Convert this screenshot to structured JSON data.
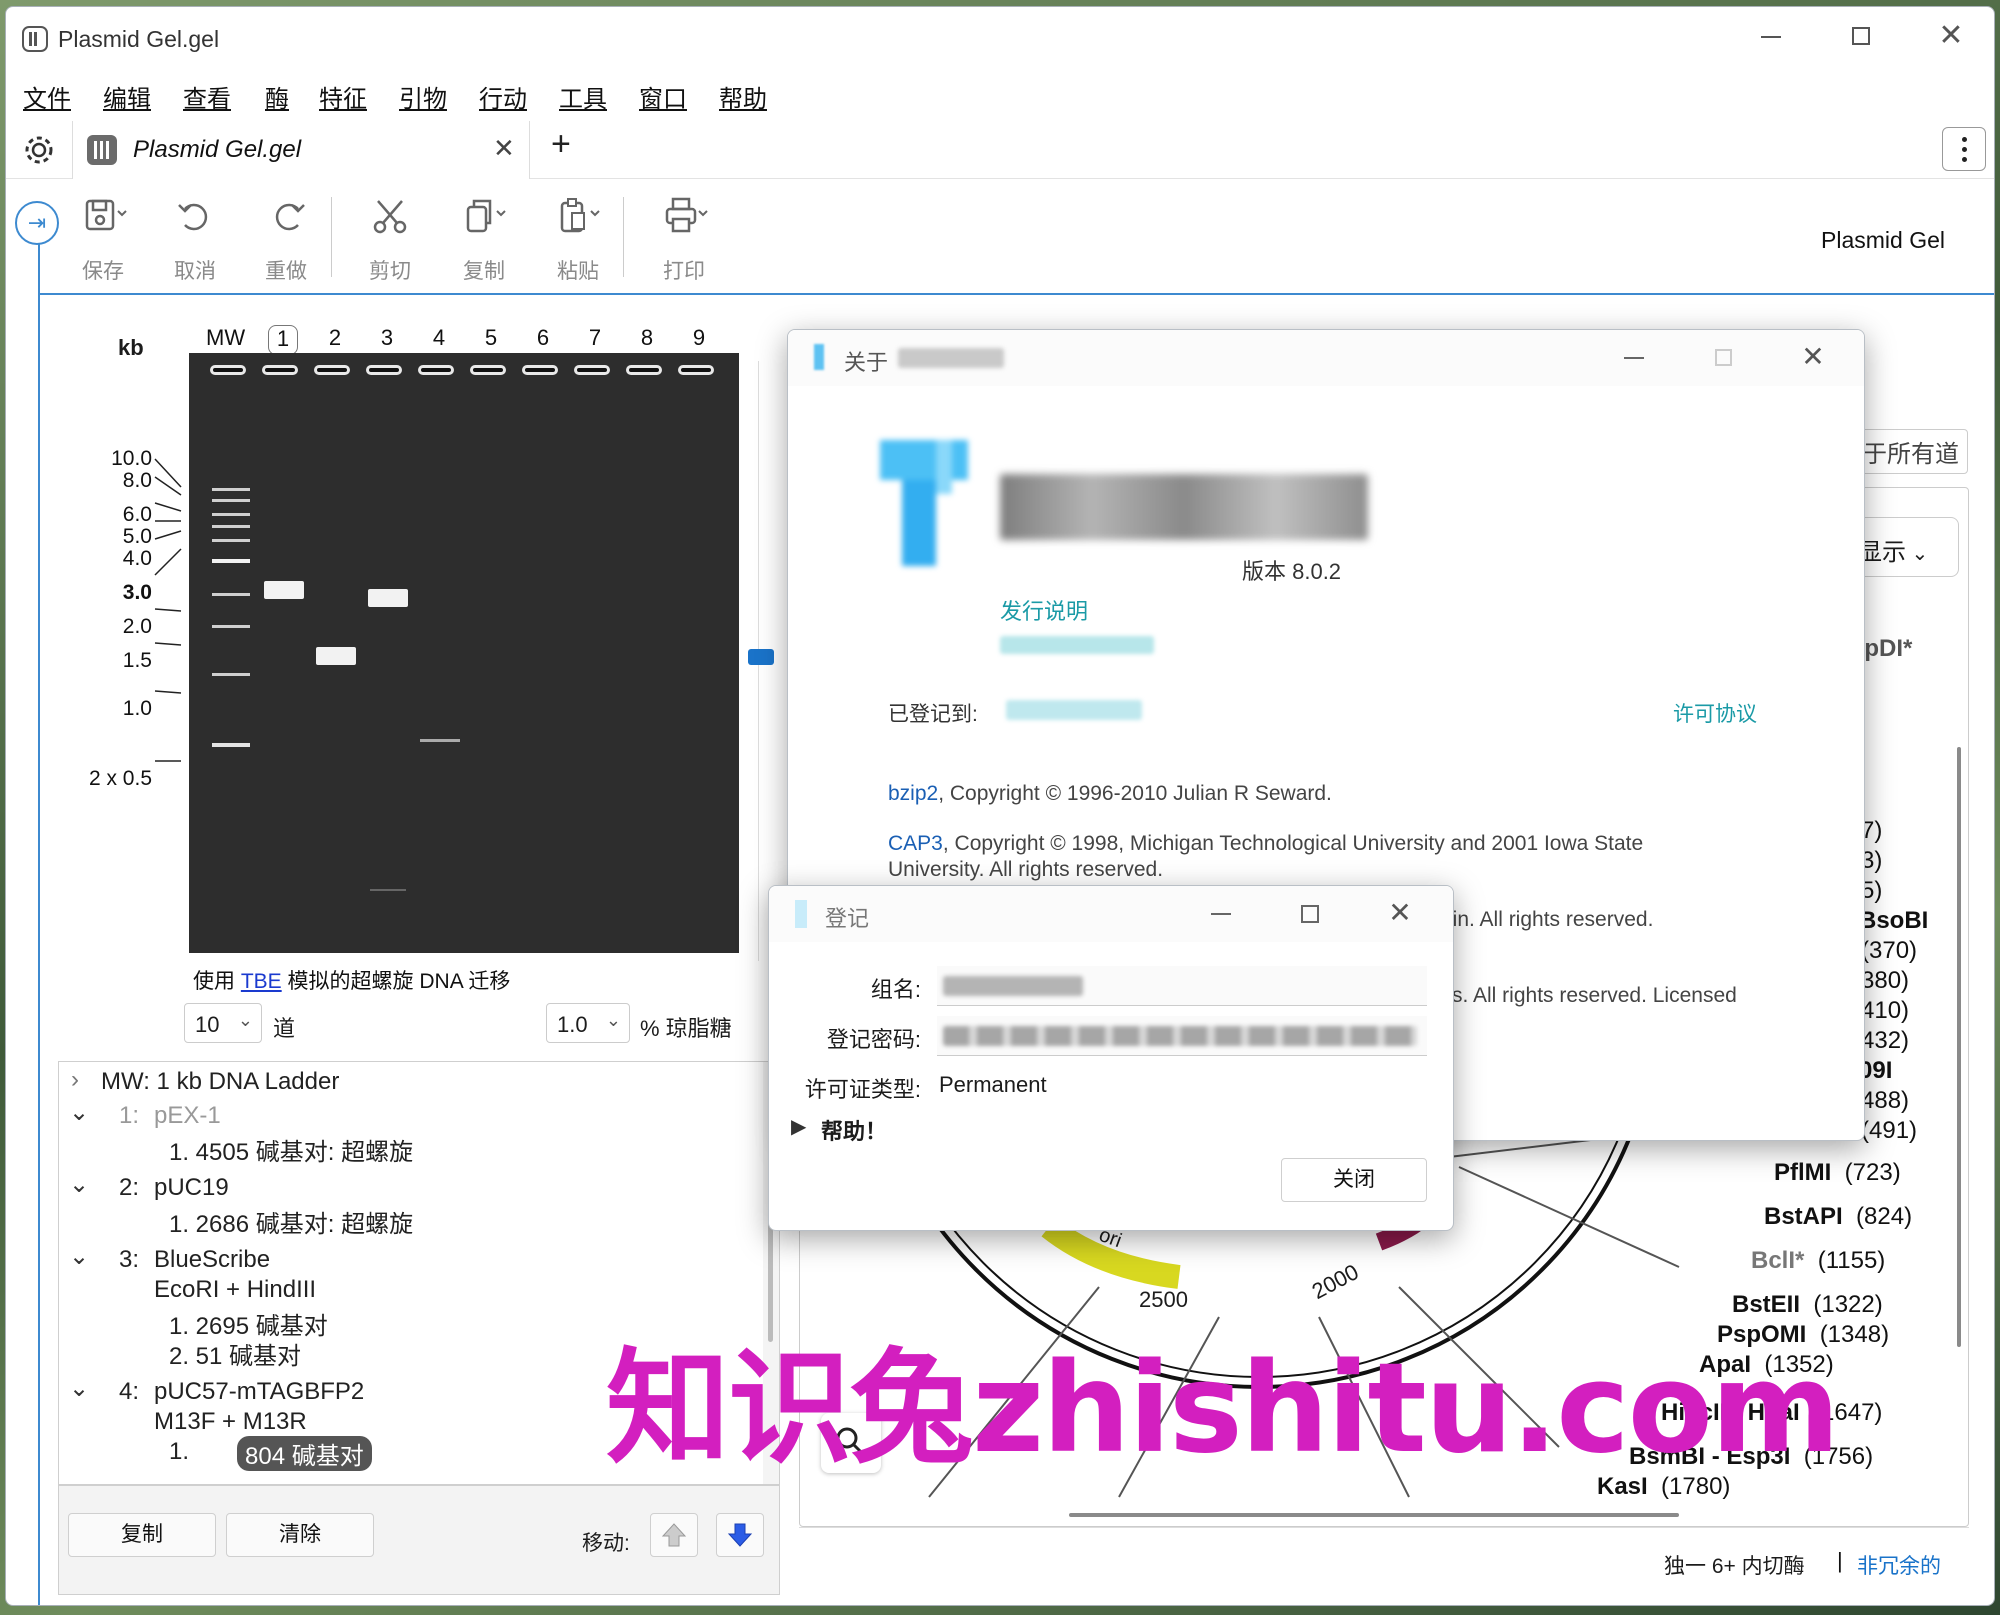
{
  "window": {
    "title": "Plasmid Gel.gel"
  },
  "menu": [
    "文件",
    "编辑",
    "查看",
    "酶",
    "特征",
    "引物",
    "行动",
    "工具",
    "窗口",
    "帮助"
  ],
  "tab": {
    "label": "Plasmid Gel.gel",
    "add": "+"
  },
  "toolbar": {
    "save": "保存",
    "undo": "取消",
    "redo": "重做",
    "cut": "剪切",
    "copy": "复制",
    "paste": "粘贴",
    "print": "打印",
    "doc_title": "Plasmid Gel"
  },
  "gel": {
    "kb_label": "kb",
    "lanes": [
      "MW",
      "1",
      "2",
      "3",
      "4",
      "5",
      "6",
      "7",
      "8",
      "9"
    ],
    "ladder_labels": [
      "10.0",
      "8.0",
      "6.0",
      "5.0",
      "4.0",
      "3.0",
      "2.0",
      "1.5",
      "1.0",
      "2 x 0.5"
    ],
    "caption_prefix": "使用",
    "caption_link": "TBE",
    "caption_suffix": "模拟的超螺旋 DNA 迁移",
    "lanes_value": "10",
    "lanes_unit": "道",
    "agarose_value": "1.0",
    "agarose_unit": "% 琼脂糖"
  },
  "lane_list": {
    "mw": "MW:  1 kb DNA Ladder",
    "l1": "1:",
    "l1_name": "pEX-1",
    "l1_f1": "1.  4505 碱基对:  超螺旋",
    "l2": "2:",
    "l2_name": "pUC19",
    "l2_f1": "1.  2686 碱基对:  超螺旋",
    "l3": "3:",
    "l3_name": "BlueScribe",
    "l3_enz": "EcoRI + HindIII",
    "l3_f1": "1.  2695 碱基对",
    "l3_f2": "2.      51 碱基对",
    "l4": "4:",
    "l4_name": "pUC57-mTAGBFP2",
    "l4_primers": "M13F + M13R",
    "l4_num": "1.",
    "l4_f1": "804 碱基对"
  },
  "bottom": {
    "copy": "复制",
    "clear": "清除",
    "move": "移动:"
  },
  "about": {
    "title": "关于",
    "version": "版本 8.0.2",
    "release_notes": "发行说明",
    "registered_to": "已登记到:",
    "license": "许可协议",
    "bzip2_link": "bzip2",
    "bzip2_text": ", Copyright © 1996-2010 Julian R Seward.",
    "cap3_link": "CAP3",
    "cap3_text": ", Copyright © 1998, Michigan Technological University and 2001 Iowa State",
    "cap3_text2": "University. All rights reserved.",
    "line3": "lin. All rights reserved.",
    "line4": "s. All rights reserved. Licensed"
  },
  "register": {
    "title": "登记",
    "group": "组名:",
    "password": "登记密码:",
    "license_type": "许可证类型:",
    "license_value": "Permanent",
    "help": "帮助！",
    "close": "关闭"
  },
  "map": {
    "all_lanes": "于所有道",
    "show": "显示",
    "enzyme_top": "spDI*",
    "partial": [
      "7)",
      "3)",
      "5)",
      "BsoBI",
      "(370)",
      "380)",
      "410)",
      "432)",
      "09I",
      "488)",
      "(491)"
    ],
    "enzymes": [
      {
        "name": "PflMI",
        "pos": "(723)"
      },
      {
        "name": "BstAPI",
        "pos": "(824)"
      },
      {
        "name": "BclI*",
        "pos": "(1155)"
      },
      {
        "name": "BstEII",
        "pos": "(1322)"
      },
      {
        "name": "PspOMI",
        "pos": "(1348)"
      },
      {
        "name": "ApaI",
        "pos": "(1352)"
      },
      {
        "name": "HincII - HpaI",
        "pos": "(1647)"
      },
      {
        "name": "BsmBI - Esp3I",
        "pos": "(1756)"
      },
      {
        "name": "KasI",
        "pos": "(1780)"
      }
    ],
    "ticks": [
      "2500",
      "2000"
    ],
    "ori": "ori",
    "footer_label": "独一 6+ 内切酶",
    "footer_link": "非冗余的"
  },
  "watermark": "知识兔zhishitu.com",
  "colors": {
    "accent": "#3d8ad0",
    "link": "#1a73c9",
    "teal": "#20a0a8",
    "watermark": "#d31fbf"
  }
}
